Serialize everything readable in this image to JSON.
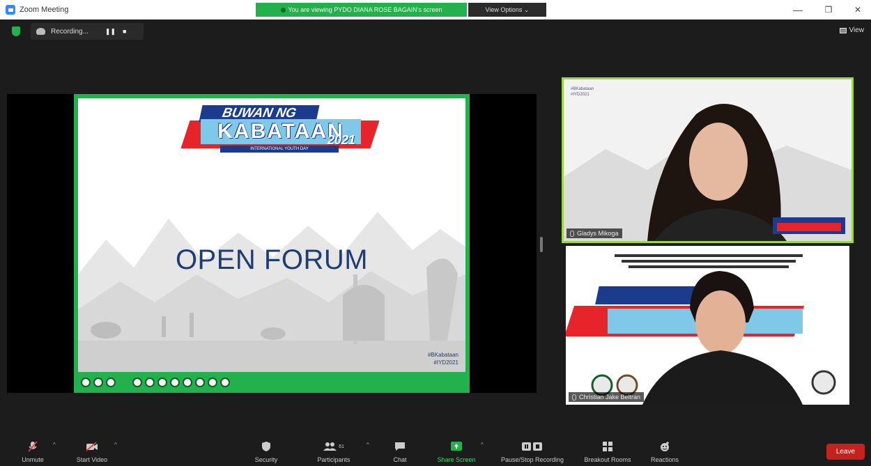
{
  "window": {
    "title": "Zoom Meeting",
    "viewing_banner": "You are viewing PYDO DIANA ROSE BAGAIN's screen",
    "view_options": "View Options ⌄",
    "minimize": "—",
    "restore": "❐",
    "close": "✕"
  },
  "topbar": {
    "recording_label": "Recording...",
    "pause_symbol": "❚❚",
    "stop_symbol": "■",
    "view_label": "View"
  },
  "slide": {
    "logo_top": "BUWAN NG",
    "logo_main": "KABATAAN",
    "logo_year": "2021",
    "logo_sub": "INTERNATIONAL YOUTH DAY",
    "title": "OPEN FORUM",
    "hashtag_line1": "#BKabataan",
    "hashtag_line2": "#IYD2021"
  },
  "participants": [
    {
      "name": "Gladys Mikoga"
    },
    {
      "name": "Christian Jake Beltran"
    }
  ],
  "toolbar": {
    "items": [
      {
        "label": "Unmute",
        "icon": "microphone-muted-icon"
      },
      {
        "label": "Start Video",
        "icon": "camera-off-icon"
      },
      {
        "label": "Security",
        "icon": "shield-icon"
      },
      {
        "label": "Participants",
        "icon": "participants-icon",
        "count": "61"
      },
      {
        "label": "Chat",
        "icon": "chat-icon"
      },
      {
        "label": "Share Screen",
        "icon": "share-screen-icon"
      },
      {
        "label": "Pause/Stop Recording",
        "icon": "recording-controls-icon"
      },
      {
        "label": "Breakout Rooms",
        "icon": "breakout-rooms-icon"
      },
      {
        "label": "Reactions",
        "icon": "reactions-icon"
      }
    ],
    "leave_label": "Leave"
  },
  "colors": {
    "share_green": "#22b14c",
    "active_speaker_border": "#9ed64a",
    "leave_red": "#c4221d",
    "slide_title": "#1d3d73"
  }
}
